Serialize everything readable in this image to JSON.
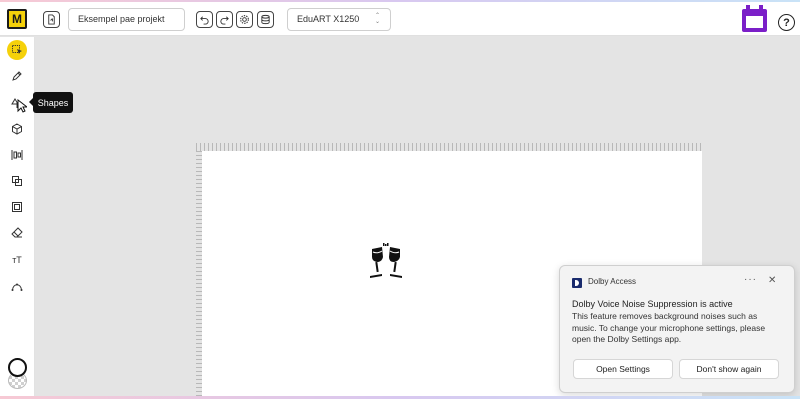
{
  "header": {
    "logo_letter": "M",
    "project_name": "Eksempel pae projekt",
    "machine": "EduART X1250",
    "help_symbol": "?",
    "icons": [
      "open-file-icon",
      "undo-icon",
      "redo-icon",
      "settings-icon",
      "database-icon",
      "calendar-icon",
      "help-icon"
    ]
  },
  "toolbar": {
    "tools": [
      "select-icon",
      "pen-icon",
      "shapes-icon",
      "cube-icon",
      "align-icon",
      "arrange-icon",
      "frame-icon",
      "eraser-icon",
      "text-icon",
      "curve-icon"
    ],
    "active_tool": "select-icon",
    "tooltip": "Shapes",
    "text_tool_glyph": "тT"
  },
  "canvas": {
    "content_icon": "champagne-toast-icon"
  },
  "notification": {
    "app_name": "Dolby Access",
    "more": "···",
    "close": "✕",
    "title": "Dolby Voice Noise Suppression is active",
    "body": "This feature removes background noises such as music. To change your microphone settings, please open the Dolby Settings app.",
    "primary_button": "Open Settings",
    "secondary_button": "Don't show again"
  },
  "colors": {
    "accent": "#f5d10a",
    "calendar": "#7b1fc8",
    "notification_bg": "#f3f3f3",
    "dolby_icon": "#1a2b6d"
  }
}
